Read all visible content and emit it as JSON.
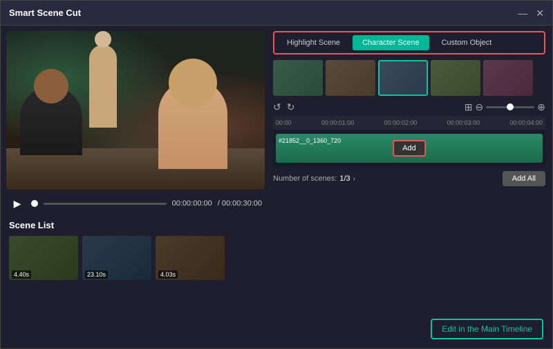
{
  "window": {
    "title": "Smart Scene Cut",
    "minimize_label": "—",
    "close_label": "✕"
  },
  "tabs": {
    "items": [
      {
        "id": "highlight",
        "label": "Highlight Scene",
        "active": false
      },
      {
        "id": "character",
        "label": "Character Scene",
        "active": true
      },
      {
        "id": "custom",
        "label": "Custom Object",
        "active": false
      }
    ]
  },
  "thumbnails": [
    {
      "id": "t1",
      "class": "s1",
      "selected": false
    },
    {
      "id": "t2",
      "class": "s2",
      "selected": false
    },
    {
      "id": "t3",
      "class": "s3",
      "selected": true
    },
    {
      "id": "t4",
      "class": "s4",
      "selected": false
    },
    {
      "id": "t5",
      "class": "s5",
      "selected": false
    }
  ],
  "timeline": {
    "ruler_marks": [
      "00:00",
      "00:00:01:00",
      "00:00:02:00",
      "00:00:03:00",
      "00:00:04:00"
    ],
    "clip_label": "#21852__0_1360_720",
    "add_button_label": "Add"
  },
  "playback": {
    "current_time": "00:00:00:00",
    "total_time": "/ 00:00:30:00"
  },
  "scenes": {
    "label": "Scene List",
    "info_label": "Number of scenes:",
    "count": "1/3",
    "items": [
      {
        "duration": "4.40s",
        "class": "t1"
      },
      {
        "duration": "23.10s",
        "class": "t2"
      },
      {
        "duration": "4.03s",
        "class": "t3"
      }
    ],
    "add_all_label": "Add All"
  },
  "edit_btn": {
    "label": "Edit in the Main Timeline"
  }
}
